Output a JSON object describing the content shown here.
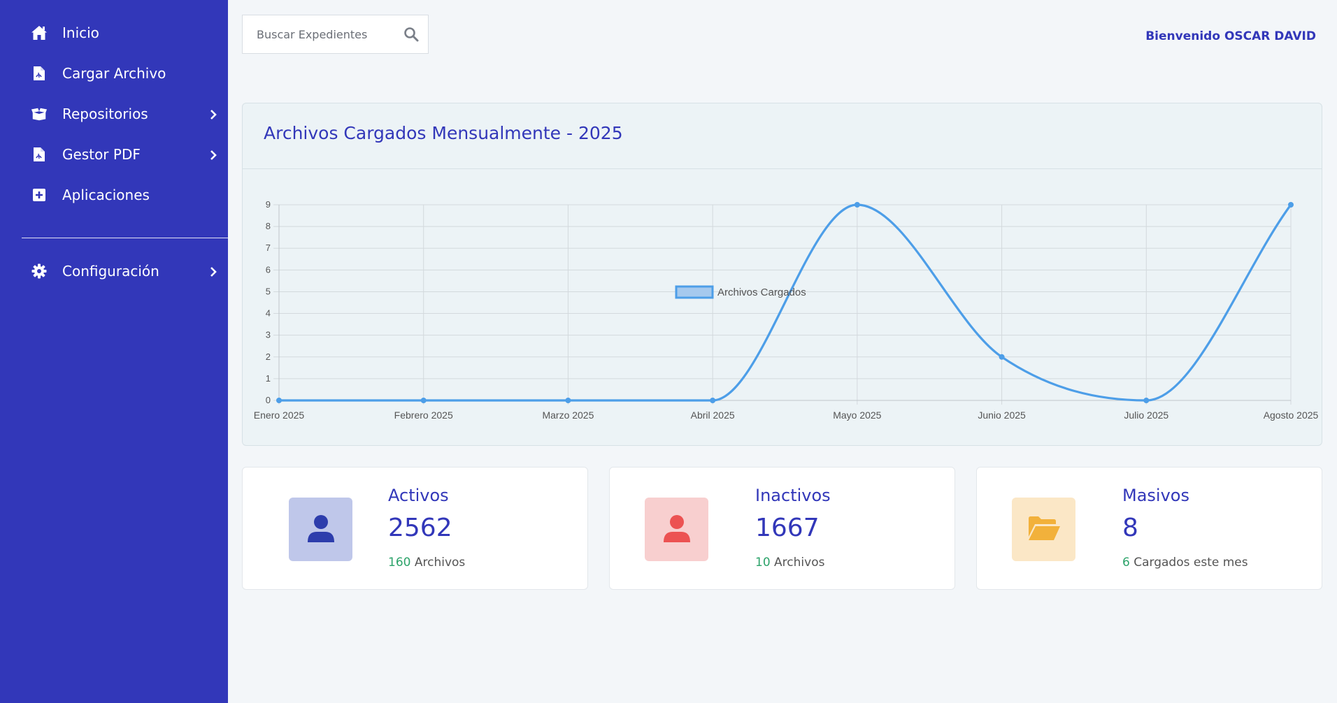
{
  "sidebar": {
    "items": [
      {
        "label": "Inicio",
        "icon": "home-icon"
      },
      {
        "label": "Cargar Archivo",
        "icon": "pdf-file-icon"
      },
      {
        "label": "Repositorios",
        "icon": "box-icon"
      },
      {
        "label": "Gestor PDF",
        "icon": "pdf-file-icon"
      },
      {
        "label": "Aplicaciones",
        "icon": "plus-square-icon"
      },
      {
        "label": "Configuración",
        "icon": "gear-icon"
      }
    ]
  },
  "header": {
    "search_placeholder": "Buscar Expedientes",
    "welcome": "Bienvenido OSCAR DAVID"
  },
  "chart_card": {
    "title": "Archivos Cargados Mensualmente - 2025"
  },
  "chart_data": {
    "type": "line",
    "categories": [
      "Enero 2025",
      "Febrero 2025",
      "Marzo 2025",
      "Abril 2025",
      "Mayo 2025",
      "Junio 2025",
      "Julio 2025",
      "Agosto 2025"
    ],
    "series": [
      {
        "name": "Archivos Cargados",
        "values": [
          0,
          0,
          0,
          0,
          9,
          2,
          0,
          9
        ]
      }
    ],
    "ylim": [
      0,
      9
    ],
    "yticks": [
      0,
      1,
      2,
      3,
      4,
      5,
      6,
      7,
      8,
      9
    ],
    "grid": true,
    "legend": "top-center",
    "color": "#4d9ee8"
  },
  "stats": [
    {
      "title": "Activos",
      "value": "2562",
      "sub_num": "160",
      "sub_text": "Archivos",
      "icon": "user-icon",
      "icon_color": "#2d3dac",
      "bg": "#bfc7ea"
    },
    {
      "title": "Inactivos",
      "value": "1667",
      "sub_num": "10",
      "sub_text": "Archivos",
      "icon": "user-icon",
      "icon_color": "#ec5252",
      "bg": "#f8cfcf"
    },
    {
      "title": "Masivos",
      "value": "8",
      "sub_num": "6",
      "sub_text": "Cargados este mes",
      "icon": "folder-open-icon",
      "icon_color": "#f2b13b",
      "bg": "#fbe7c6"
    }
  ]
}
